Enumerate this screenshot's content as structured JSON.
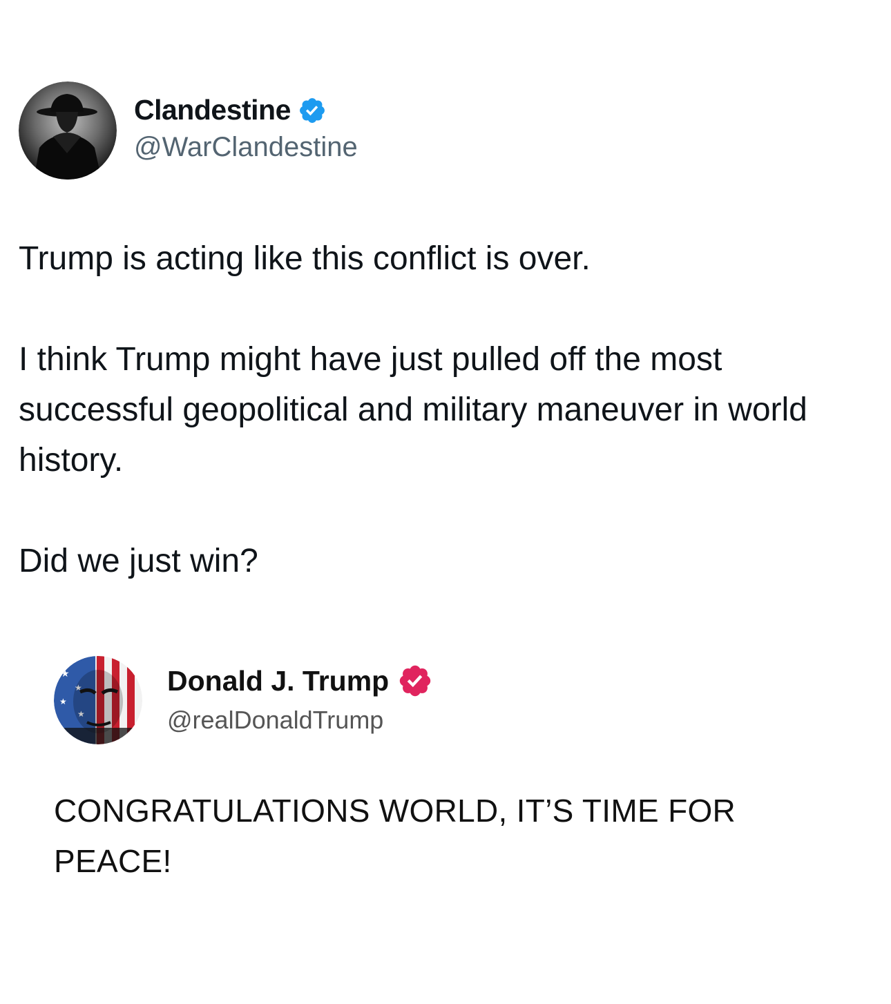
{
  "tweet": {
    "author": {
      "display_name": "Clandestine",
      "handle": "@WarClandestine",
      "verified_icon": "verified-badge-blue"
    },
    "paragraphs": [
      "Trump is acting like this conflict is over.",
      "I think Trump might have just pulled off the most successful geopolitical and military maneuver in world history.",
      "Did we just win?"
    ]
  },
  "quoted_post": {
    "author": {
      "display_name": "Donald J. Trump",
      "handle": "@realDonaldTrump",
      "verified_icon": "verified-badge-red"
    },
    "text": "CONGRATULATIONS WORLD, IT’S TIME FOR PEACE!"
  },
  "colors": {
    "text_primary": "#0f1419",
    "text_secondary": "#536471",
    "badge_blue": "#1d9bf0",
    "badge_red": "#e0245e"
  }
}
